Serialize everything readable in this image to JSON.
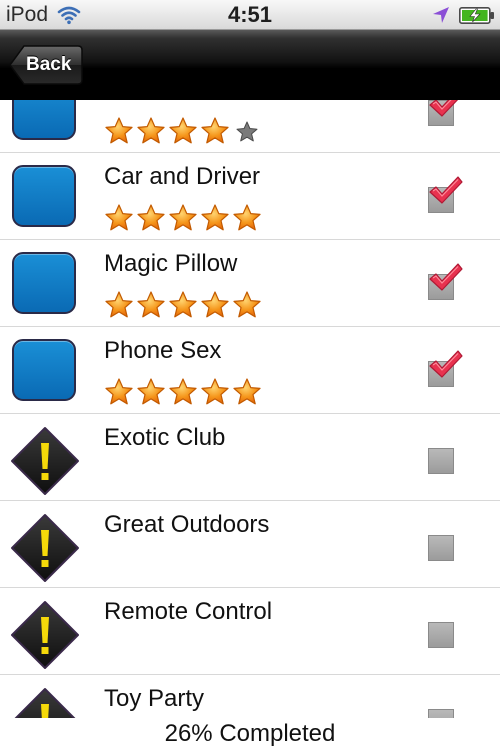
{
  "status_bar": {
    "carrier": "iPod",
    "time": "4:51",
    "icons": [
      "wifi-icon",
      "location-icon",
      "battery-charging-icon"
    ]
  },
  "nav_bar": {
    "back_label": "Back"
  },
  "colors": {
    "tile_blue": "#0a7ac6",
    "warning_black": "#1a1a1a",
    "warning_yellow": "#f5d90a",
    "check_red": "#e8324f",
    "star_orange": "#f28a12",
    "star_empty": "#7a7a7a"
  },
  "items": [
    {
      "title": "",
      "icon": "blue-tile-icon",
      "rating": 4,
      "max_rating": 5,
      "checked": true
    },
    {
      "title": "Car and Driver",
      "icon": "blue-tile-icon",
      "rating": 5,
      "max_rating": 5,
      "checked": true
    },
    {
      "title": "Magic Pillow",
      "icon": "blue-tile-icon",
      "rating": 5,
      "max_rating": 5,
      "checked": true
    },
    {
      "title": "Phone Sex",
      "icon": "blue-tile-icon",
      "rating": 5,
      "max_rating": 5,
      "checked": true
    },
    {
      "title": "Exotic Club",
      "icon": "warning-icon",
      "rating": 0,
      "max_rating": 0,
      "checked": false
    },
    {
      "title": "Great Outdoors",
      "icon": "warning-icon",
      "rating": 0,
      "max_rating": 0,
      "checked": false
    },
    {
      "title": "Remote Control",
      "icon": "warning-icon",
      "rating": 0,
      "max_rating": 0,
      "checked": false
    },
    {
      "title": "Toy Party",
      "icon": "warning-icon",
      "rating": 0,
      "max_rating": 0,
      "checked": false
    }
  ],
  "footer": {
    "progress_text": "26% Completed",
    "progress_percent": 26
  }
}
